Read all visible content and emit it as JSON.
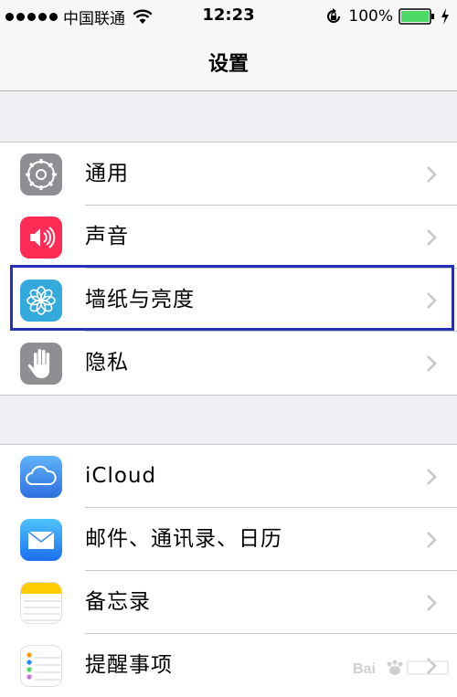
{
  "status_bar": {
    "carrier": "中国联通",
    "time": "12:23",
    "battery_percent": "100%"
  },
  "nav": {
    "title": "设置"
  },
  "groups": [
    {
      "items": [
        {
          "label": "通用",
          "icon": "gear-icon",
          "color": "#8e8e93"
        },
        {
          "label": "声音",
          "icon": "speaker-icon",
          "color": "#ff2d55"
        },
        {
          "label": "墙纸与亮度",
          "icon": "flower-icon",
          "color": "#34aadc"
        },
        {
          "label": "隐私",
          "icon": "hand-icon",
          "color": "#8e8e93"
        }
      ]
    },
    {
      "items": [
        {
          "label": "iCloud",
          "icon": "cloud-icon",
          "color": "#1d77f2"
        },
        {
          "label": "邮件、通讯录、日历",
          "icon": "mail-icon",
          "color": "#1d8cf8"
        },
        {
          "label": "备忘录",
          "icon": "notes-icon",
          "color": "#ffcc00"
        },
        {
          "label": "提醒事项",
          "icon": "reminders-icon",
          "color": "#ffffff"
        }
      ]
    }
  ],
  "highlighted_item": "墙纸与亮度",
  "colors": {
    "highlight_border": "#2630b6",
    "battery_green": "#4cd964",
    "background": "#efeff4"
  }
}
